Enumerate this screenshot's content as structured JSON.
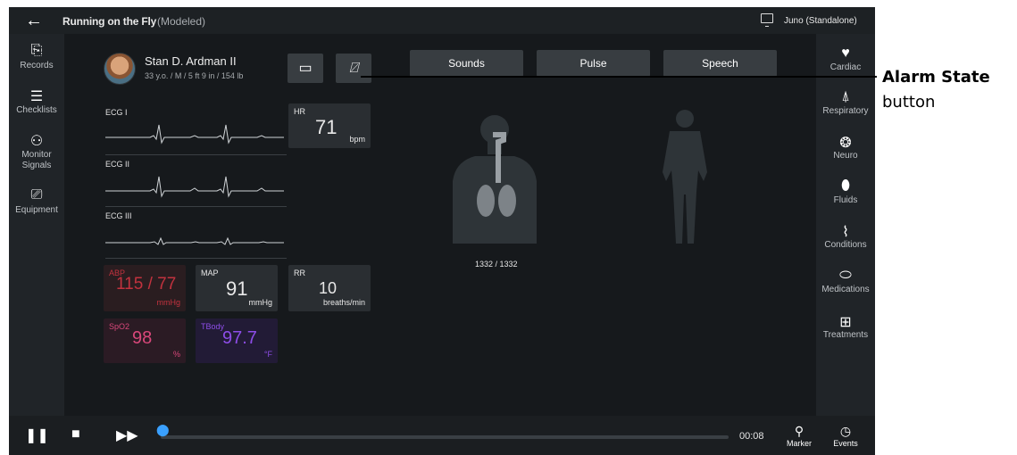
{
  "topbar": {
    "back_icon": "arrow-left-icon",
    "scenario_title": "Running on the Fly",
    "scenario_mode": "(Modeled)",
    "screen_icon": "monitor-icon",
    "user": "Juno (Standalone)"
  },
  "leftnav": [
    {
      "label": "Records",
      "icon": "clipboard-icon",
      "glyph": "⎘"
    },
    {
      "label": "Checklists",
      "icon": "checklist-icon",
      "glyph": "☰"
    },
    {
      "label": "Monitor Signals",
      "icon": "monitor-signals-icon",
      "glyph": "⚇"
    },
    {
      "label": "Equipment",
      "icon": "equipment-monitor-icon",
      "glyph": "⎚"
    }
  ],
  "patient": {
    "name": "Stan D. Ardman II",
    "info": "33 y.o. / M / 5 ft 9 in / 154 lb"
  },
  "toolbar": {
    "layout_icon": "layout-icon",
    "alarm_icon": "alarm-state-icon"
  },
  "tabs": {
    "sounds": "Sounds",
    "pulse": "Pulse",
    "speech": "Speech"
  },
  "ecg": [
    {
      "label": "ECG I"
    },
    {
      "label": "ECG II"
    },
    {
      "label": "ECG III"
    }
  ],
  "vitals": {
    "hr": {
      "label": "HR",
      "value": "71",
      "unit": "bpm"
    },
    "abp": {
      "label": "ABP",
      "value": "115 / 77",
      "unit": "mmHg"
    },
    "map": {
      "label": "MAP",
      "value": "91",
      "unit": "mmHg"
    },
    "rr": {
      "label": "RR",
      "value": "10",
      "unit": "breaths/min"
    },
    "spo2": {
      "label": "SpO2",
      "value": "98",
      "unit": "%"
    },
    "tbody": {
      "label": "TBody",
      "value": "97.7",
      "unit": "°F"
    }
  },
  "anatomy": {
    "time_caption": "1332 / 1332"
  },
  "rightnav": [
    {
      "label": "Cardiac",
      "icon": "heart-icon",
      "glyph": "♥"
    },
    {
      "label": "Respiratory",
      "icon": "lungs-icon",
      "glyph": "⍋"
    },
    {
      "label": "Neuro",
      "icon": "brain-icon",
      "glyph": "❂"
    },
    {
      "label": "Fluids",
      "icon": "drop-icon",
      "glyph": "⬮"
    },
    {
      "label": "Conditions",
      "icon": "pulse-line-icon",
      "glyph": "⌇"
    },
    {
      "label": "Medications",
      "icon": "pill-icon",
      "glyph": "⬭"
    },
    {
      "label": "Treatments",
      "icon": "first-aid-icon",
      "glyph": "⊞"
    }
  ],
  "bottombar": {
    "pause_icon": "pause-icon",
    "stop_icon": "stop-icon",
    "fast_forward_icon": "fast-forward-icon",
    "progress_fraction": 0.0,
    "time": "00:08",
    "marker_label": "Marker",
    "events_label": "Events"
  },
  "callout": {
    "title": "Alarm State",
    "subtitle": "button"
  },
  "colors": {
    "abp": "#c2323e",
    "spo2": "#d9477a",
    "tbody": "#8d4de8",
    "accent": "#3aa0ff"
  }
}
